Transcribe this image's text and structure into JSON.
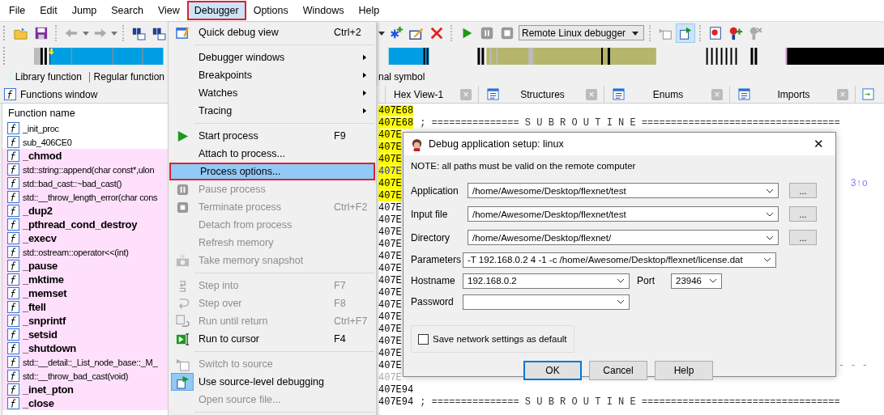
{
  "menubar": [
    {
      "label": "File",
      "selected": false
    },
    {
      "label": "Edit",
      "selected": false
    },
    {
      "label": "Jump",
      "selected": false
    },
    {
      "label": "Search",
      "selected": false
    },
    {
      "label": "View",
      "selected": false
    },
    {
      "label": "Debugger",
      "selected": true
    },
    {
      "label": "Options",
      "selected": false
    },
    {
      "label": "Windows",
      "selected": false
    },
    {
      "label": "Help",
      "selected": false
    }
  ],
  "toolbar": {
    "debugger_select": "Remote Linux debugger"
  },
  "legend": [
    {
      "label": "Library function",
      "color": "#b3ffff"
    },
    {
      "label": "Regular function",
      "color": "#009fe3"
    },
    {
      "label": "nal symbol"
    }
  ],
  "functions_window": {
    "title": "Functions window",
    "column": "Function name",
    "rows": [
      {
        "name": "_init_proc",
        "kind": "regular"
      },
      {
        "name": "sub_406CE0",
        "kind": "regular"
      },
      {
        "name": "_chmod",
        "kind": "import"
      },
      {
        "name": "std::string::append(char const*,ulon",
        "kind": "library"
      },
      {
        "name": "std::bad_cast::~bad_cast()",
        "kind": "library"
      },
      {
        "name": "std::__throw_length_error(char cons",
        "kind": "library"
      },
      {
        "name": "_dup2",
        "kind": "import"
      },
      {
        "name": "_pthread_cond_destroy",
        "kind": "import"
      },
      {
        "name": "_execv",
        "kind": "import"
      },
      {
        "name": "std::ostream::operator<<(int)",
        "kind": "library"
      },
      {
        "name": "_pause",
        "kind": "import"
      },
      {
        "name": "_mktime",
        "kind": "import"
      },
      {
        "name": "_memset",
        "kind": "import"
      },
      {
        "name": "_ftell",
        "kind": "import"
      },
      {
        "name": "_snprintf",
        "kind": "import"
      },
      {
        "name": "_setsid",
        "kind": "import"
      },
      {
        "name": "_shutdown",
        "kind": "import"
      },
      {
        "name": "std::__detail::_List_node_base::_M_",
        "kind": "library"
      },
      {
        "name": "std::__throw_bad_cast(void)",
        "kind": "library"
      },
      {
        "name": "_inet_pton",
        "kind": "import"
      },
      {
        "name": "_close",
        "kind": "import"
      }
    ]
  },
  "tabs": [
    {
      "label": "Hex View-1",
      "close": "×"
    },
    {
      "label": "Structures",
      "close": "×"
    },
    {
      "label": "Enums",
      "close": "×"
    },
    {
      "label": "Imports",
      "close": "×"
    }
  ],
  "listing": [
    {
      "text": "407E68",
      "highlighted": true,
      "kind": "code"
    },
    {
      "text": "407E68",
      "comment": "; =============== S U B R O U T I N E ==================================",
      "highlighted": true,
      "kind": "code"
    },
    {
      "text": "407E",
      "highlighted": true,
      "kind": "code"
    },
    {
      "text": "407E",
      "highlighted": true,
      "kind": "code"
    },
    {
      "text": "407E",
      "highlighted": true,
      "kind": "code"
    },
    {
      "text": "407E",
      "highlighted": true,
      "kind": "link"
    },
    {
      "text": "407E",
      "highlighted": true,
      "kind": "code",
      "tail": "3↑o"
    },
    {
      "text": "407E",
      "highlighted": true,
      "kind": "code"
    },
    {
      "text": "407E",
      "highlighted": false,
      "kind": "code"
    },
    {
      "text": "407E",
      "highlighted": false,
      "kind": "code"
    },
    {
      "text": "407E",
      "highlighted": false,
      "kind": "code"
    },
    {
      "text": "407E",
      "highlighted": false,
      "kind": "code"
    },
    {
      "text": "407E",
      "highlighted": false,
      "kind": "code"
    },
    {
      "text": "407E",
      "highlighted": false,
      "kind": "code"
    },
    {
      "text": "407E",
      "highlighted": false,
      "kind": "code"
    },
    {
      "text": "407E",
      "highlighted": false,
      "kind": "code"
    },
    {
      "text": "407E",
      "highlighted": false,
      "kind": "code"
    },
    {
      "text": "407E",
      "highlighted": false,
      "kind": "code"
    },
    {
      "text": "407E",
      "highlighted": false,
      "kind": "code"
    },
    {
      "text": "407E",
      "highlighted": false,
      "kind": "code"
    },
    {
      "text": "407E",
      "highlighted": false,
      "kind": "code"
    },
    {
      "text": "407E",
      "highlighted": false,
      "kind": "code",
      "tail": "- - -"
    },
    {
      "text": "407E",
      "highlighted": false,
      "kind": "dim"
    },
    {
      "text": "407E94",
      "highlighted": false,
      "kind": "code"
    },
    {
      "text": "407E94",
      "comment": "; =============== S U B R O U T I N E ==================================",
      "highlighted": false,
      "kind": "code"
    }
  ],
  "debugger_menu": [
    {
      "kind": "item",
      "label": "Quick debug view",
      "shortcut": "Ctrl+2",
      "disabled": false,
      "selected": false,
      "checked": false
    },
    {
      "kind": "separator"
    },
    {
      "kind": "item",
      "label": "Debugger windows",
      "submenu": true,
      "disabled": false,
      "selected": false,
      "checked": false
    },
    {
      "kind": "item",
      "label": "Breakpoints",
      "submenu": true,
      "disabled": false,
      "selected": false,
      "checked": false
    },
    {
      "kind": "item",
      "label": "Watches",
      "submenu": true,
      "disabled": false,
      "selected": false,
      "checked": false
    },
    {
      "kind": "item",
      "label": "Tracing",
      "submenu": true,
      "disabled": false,
      "selected": false,
      "checked": false
    },
    {
      "kind": "separator"
    },
    {
      "kind": "item",
      "label": "Start process",
      "shortcut": "F9",
      "disabled": false,
      "selected": false,
      "checked": false
    },
    {
      "kind": "item",
      "label": "Attach to process...",
      "disabled": false,
      "selected": false,
      "checked": false
    },
    {
      "kind": "item",
      "label": "Process options...",
      "disabled": false,
      "selected": true,
      "checked": false
    },
    {
      "kind": "item",
      "label": "Pause process",
      "disabled": true,
      "selected": false,
      "checked": false
    },
    {
      "kind": "item",
      "label": "Terminate process",
      "shortcut": "Ctrl+F2",
      "disabled": true,
      "selected": false,
      "checked": false
    },
    {
      "kind": "item",
      "label": "Detach from process",
      "disabled": true,
      "selected": false,
      "checked": false
    },
    {
      "kind": "item",
      "label": "Refresh memory",
      "disabled": true,
      "selected": false,
      "checked": false
    },
    {
      "kind": "item",
      "label": "Take memory snapshot",
      "disabled": true,
      "selected": false,
      "checked": false
    },
    {
      "kind": "separator"
    },
    {
      "kind": "item",
      "label": "Step into",
      "shortcut": "F7",
      "disabled": true,
      "selected": false,
      "checked": false
    },
    {
      "kind": "item",
      "label": "Step over",
      "shortcut": "F8",
      "disabled": true,
      "selected": false,
      "checked": false
    },
    {
      "kind": "item",
      "label": "Run until return",
      "shortcut": "Ctrl+F7",
      "disabled": true,
      "selected": false,
      "checked": false
    },
    {
      "kind": "item",
      "label": "Run to cursor",
      "shortcut": "F4",
      "disabled": false,
      "selected": false,
      "checked": false
    },
    {
      "kind": "separator"
    },
    {
      "kind": "item",
      "label": "Switch to source",
      "disabled": true,
      "selected": false,
      "checked": false
    },
    {
      "kind": "item",
      "label": "Use source-level debugging",
      "disabled": false,
      "selected": false,
      "checked": true
    },
    {
      "kind": "item",
      "label": "Open source file...",
      "disabled": true,
      "selected": false,
      "checked": false
    },
    {
      "kind": "separator"
    }
  ],
  "dialog": {
    "title": "Debug application setup: linux",
    "close": "✕",
    "note": "NOTE: all paths must be valid on the remote computer",
    "paths": [
      {
        "label": "Application",
        "value": "/home/Awesome/Desktop/flexnet/test",
        "browse": "..."
      },
      {
        "label": "Input file",
        "value": "/home/Awesome/Desktop/flexnet/test",
        "browse": "..."
      },
      {
        "label": "Directory",
        "value": "/home/Awesome/Desktop/flexnet/",
        "browse": "..."
      }
    ],
    "parameters": {
      "label": "Parameters",
      "value": "-T 192.168.0.2 4 -1 -c /home/Awesome/Desktop/flexnet/license.dat"
    },
    "hostname": {
      "label": "Hostname",
      "value": "192.168.0.2"
    },
    "port": {
      "label": "Port",
      "value": "23946"
    },
    "password": {
      "label": "Password"
    },
    "save_default": {
      "label": "Save network settings as default",
      "checked": false
    },
    "buttons": [
      {
        "label": "OK",
        "default": true
      },
      {
        "label": "Cancel",
        "default": false
      },
      {
        "label": "Help",
        "default": false
      }
    ]
  }
}
